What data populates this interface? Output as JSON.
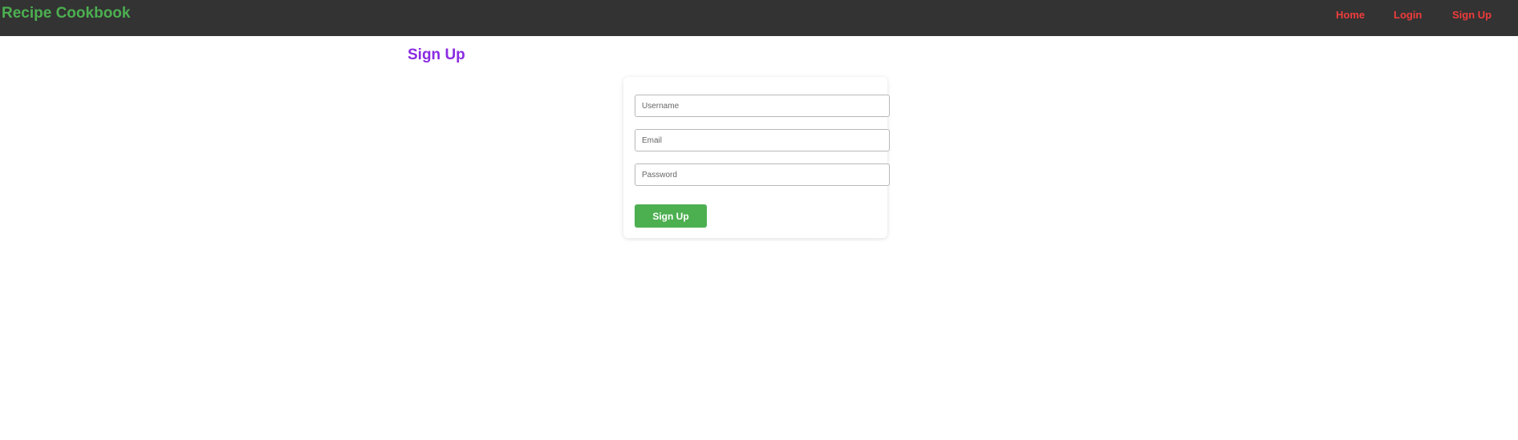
{
  "navbar": {
    "brand": "Recipe Cookbook",
    "links": [
      {
        "label": "Home"
      },
      {
        "label": "Login"
      },
      {
        "label": "Sign Up"
      }
    ]
  },
  "page": {
    "title": "Sign Up"
  },
  "form": {
    "username": {
      "placeholder": "Username",
      "value": ""
    },
    "email": {
      "placeholder": "Email",
      "value": ""
    },
    "password": {
      "placeholder": "Password",
      "value": ""
    },
    "submit_label": "Sign Up"
  },
  "colors": {
    "navbar_bg": "#333333",
    "brand": "#4caf50",
    "nav_link": "#f03c3c",
    "title": "#8a2be2",
    "button_bg": "#4caf50",
    "button_text": "#ffffff"
  }
}
